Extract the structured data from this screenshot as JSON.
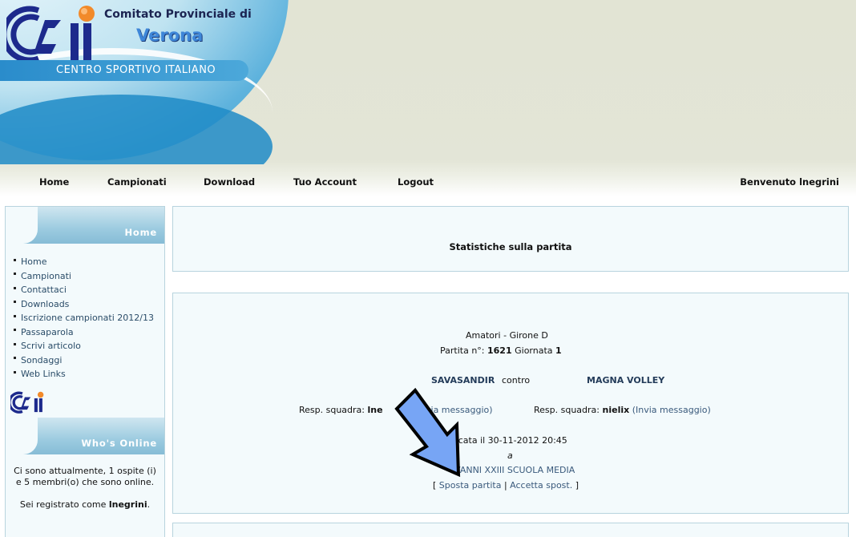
{
  "header": {
    "logo_line1": "Comitato Provinciale di",
    "logo_line2": "Verona",
    "logo_banner": "CENTRO SPORTIVO ITALIANO",
    "nav": [
      "Home",
      "Campionati",
      "Download",
      "Tuo Account",
      "Logout"
    ],
    "welcome": "Benvenuto lnegrini"
  },
  "sidebar": {
    "home_title": "Home",
    "menu": [
      "Home",
      "Campionati",
      "Contattaci",
      "Downloads",
      "Iscrizione campionati 2012/13",
      "Passaparola",
      "Scrivi articolo",
      "Sondaggi",
      "Web Links"
    ],
    "online_title": "Who's Online",
    "online_text": "Ci sono attualmente, 1 ospite (i) e 5 membri(o) che sono online.",
    "registered_prefix": "Sei registrato come ",
    "registered_user": "lnegrini",
    "registered_suffix": "."
  },
  "main": {
    "stats_title": "Statistiche sulla partita",
    "competition": "Amatori - Girone D",
    "match_label": "Partita n°:",
    "match_number": "1621",
    "round_label": "Giornata",
    "round_number": "1",
    "home_team": "SAVASANDIR",
    "vs": "contro",
    "away_team": "MAGNA VOLLEY",
    "resp_label": "Resp. squadra:",
    "home_resp": "lne",
    "away_resp": "nielix",
    "send_msg": "(Invia messaggio)",
    "send_msg_partial": "via messaggio)",
    "played_partial": "ocata il 30-11-2012 20:45",
    "at": "a",
    "venue_partial": "VANNI XXIII SCUOLA MEDIA",
    "bracket_open": "[",
    "move_match": "Sposta partita",
    "sep": "|",
    "accept_move": "Accetta spost.",
    "bracket_close": "]"
  },
  "colors": {
    "panel_bg": "#f3fafc",
    "panel_border": "#b8d4de",
    "link": "#3a5a7c",
    "arrow_fill": "#77a5f5"
  }
}
